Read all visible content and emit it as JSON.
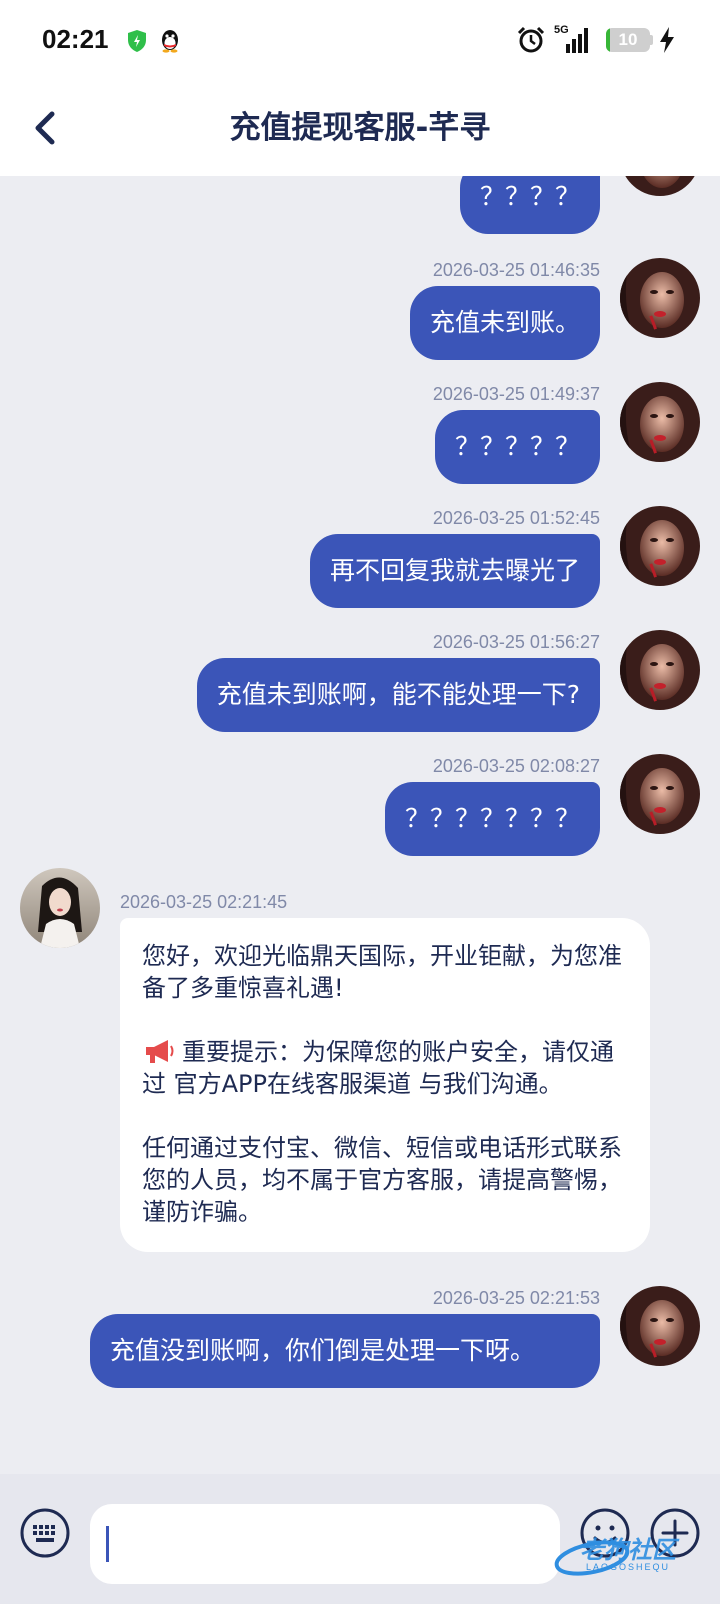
{
  "status_bar": {
    "time": "02:21",
    "network": "5G",
    "battery": "10",
    "battery_level": 0.1,
    "icons": [
      "shield-icon",
      "qq-penguin-icon",
      "alarm-icon",
      "signal-icon",
      "battery-icon",
      "charging-bolt-icon"
    ]
  },
  "header": {
    "title": "充值提现客服-芊寻",
    "back_icon": "chevron-left-icon"
  },
  "messages": [
    {
      "sender": "me",
      "time": "",
      "text": "？？？？"
    },
    {
      "sender": "me",
      "time": "2026-03-25 01:46:35",
      "text": "充值未到账。"
    },
    {
      "sender": "me",
      "time": "2026-03-25 01:49:37",
      "text": "？？？？？"
    },
    {
      "sender": "me",
      "time": "2026-03-25 01:52:45",
      "text": "再不回复我就去曝光了"
    },
    {
      "sender": "me",
      "time": "2026-03-25 01:56:27",
      "text": "充值未到账啊，能不能处理一下?"
    },
    {
      "sender": "me",
      "time": "2026-03-25 02:08:27",
      "text": "？？？？？？？"
    },
    {
      "sender": "agent",
      "time": "2026-03-25 02:21:45",
      "p1": "您好，欢迎光临鼎天国际，开业钜献，为您准备了多重惊喜礼遇!",
      "p2": "重要提示：为保障您的账户安全，请仅通过 官方APP在线客服渠道 与我们沟通。",
      "p3": "任何通过支付宝、微信、短信或电话形式联系您的人员，均不属于官方客服，请提高警惕，谨防诈骗。"
    },
    {
      "sender": "me",
      "time": "2026-03-25 02:21:53",
      "text": "充值没到账啊，你们倒是处理一下呀。"
    }
  ],
  "input_bar": {
    "placeholder": "",
    "value": "",
    "icons": [
      "keyboard-icon",
      "emoji-icon",
      "plus-icon"
    ]
  },
  "watermark": {
    "text": "老狗社区",
    "sub": "LAOGOSHEQU"
  },
  "colors": {
    "bubble_out": "#3b55b8",
    "bubble_in": "#ffffff",
    "background": "#ecedf2",
    "title": "#1e2a52",
    "timestamp": "#8089a8"
  }
}
